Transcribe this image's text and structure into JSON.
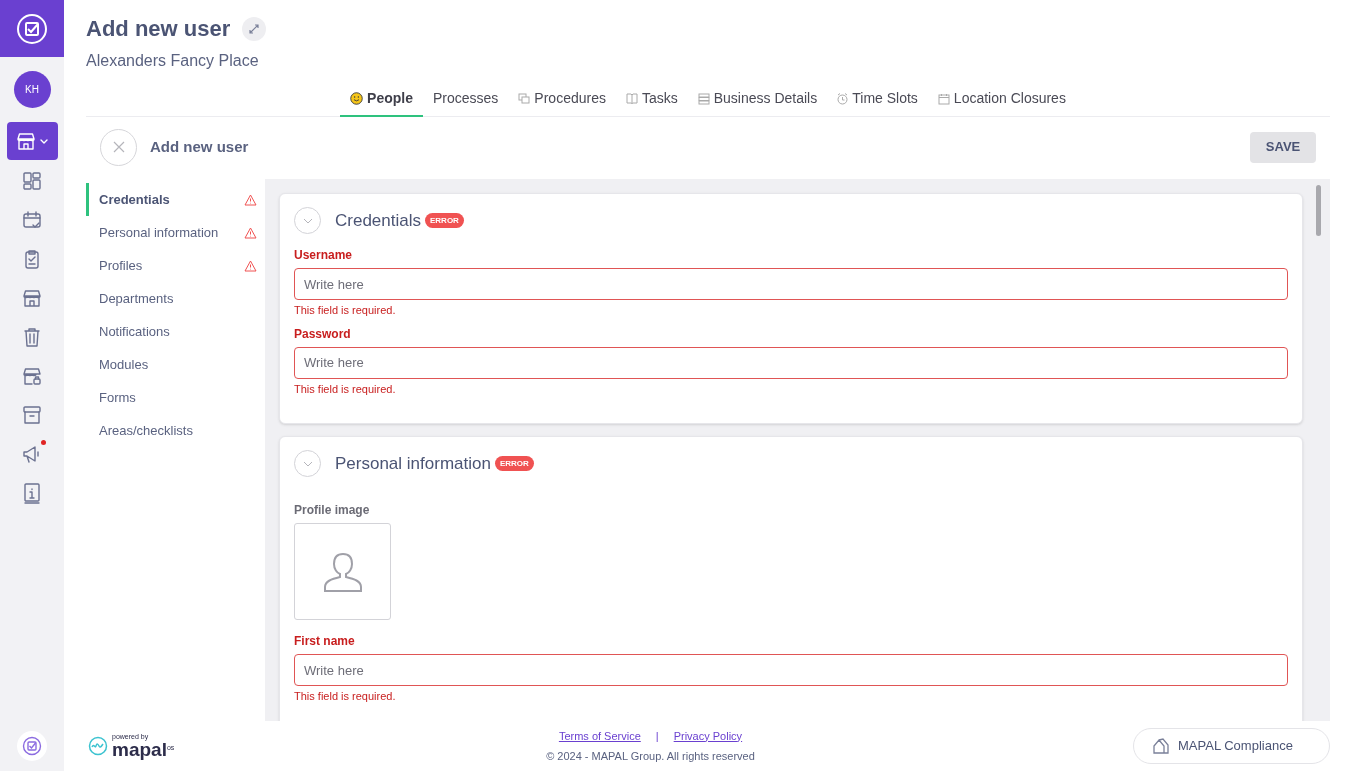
{
  "rail": {
    "avatar": "KH",
    "items": [
      {
        "selected": true,
        "notification": false
      },
      {
        "selected": false,
        "notification": false
      },
      {
        "selected": false,
        "notification": false
      },
      {
        "selected": false,
        "notification": false
      },
      {
        "selected": false,
        "notification": false
      },
      {
        "selected": false,
        "notification": false
      },
      {
        "selected": false,
        "notification": false
      },
      {
        "selected": false,
        "notification": false
      },
      {
        "selected": false,
        "notification": true
      },
      {
        "selected": false,
        "notification": false
      }
    ]
  },
  "header": {
    "title": "Add new user",
    "subtitle": "Alexanders Fancy Place"
  },
  "tabs": [
    {
      "label": "People",
      "selected": true
    },
    {
      "label": "Processes",
      "selected": false
    },
    {
      "label": "Procedures",
      "selected": false
    },
    {
      "label": "Tasks",
      "selected": false
    },
    {
      "label": "Business Details",
      "selected": false
    },
    {
      "label": "Time Slots",
      "selected": false
    },
    {
      "label": "Location Closures",
      "selected": false
    }
  ],
  "form_header": {
    "title": "Add new user",
    "save": "SAVE"
  },
  "nav": [
    {
      "label": "Credentials",
      "selected": true,
      "error": true
    },
    {
      "label": "Personal information",
      "selected": false,
      "error": true
    },
    {
      "label": "Profiles",
      "selected": false,
      "error": true
    },
    {
      "label": "Departments",
      "selected": false,
      "error": false
    },
    {
      "label": "Notifications",
      "selected": false,
      "error": false
    },
    {
      "label": "Modules",
      "selected": false,
      "error": false
    },
    {
      "label": "Forms",
      "selected": false,
      "error": false
    },
    {
      "label": "Areas/checklists",
      "selected": false,
      "error": false
    }
  ],
  "sections": [
    {
      "title": "Credentials",
      "badge": "ERROR",
      "fields": [
        {
          "kind": "text",
          "label": "Username",
          "placeholder": "Write here",
          "invalid": true,
          "message": "This field is required."
        },
        {
          "kind": "text",
          "label": "Password",
          "placeholder": "Write here",
          "invalid": true,
          "message": "This field is required."
        }
      ]
    },
    {
      "title": "Personal information",
      "badge": "ERROR",
      "fields": [
        {
          "kind": "image",
          "label": "Profile image",
          "invalid": false
        },
        {
          "kind": "text",
          "label": "First name",
          "placeholder": "Write here",
          "invalid": true,
          "message": "This field is required."
        }
      ]
    }
  ],
  "footer": {
    "powered_by": "powered by",
    "brand": "mapal",
    "brand_suffix": "os",
    "links": [
      "Terms of Service",
      "Privacy Policy"
    ],
    "separator": "|",
    "copyright": "© 2024 - MAPAL Group. All rights reserved",
    "compliance": "MAPAL Compliance"
  }
}
